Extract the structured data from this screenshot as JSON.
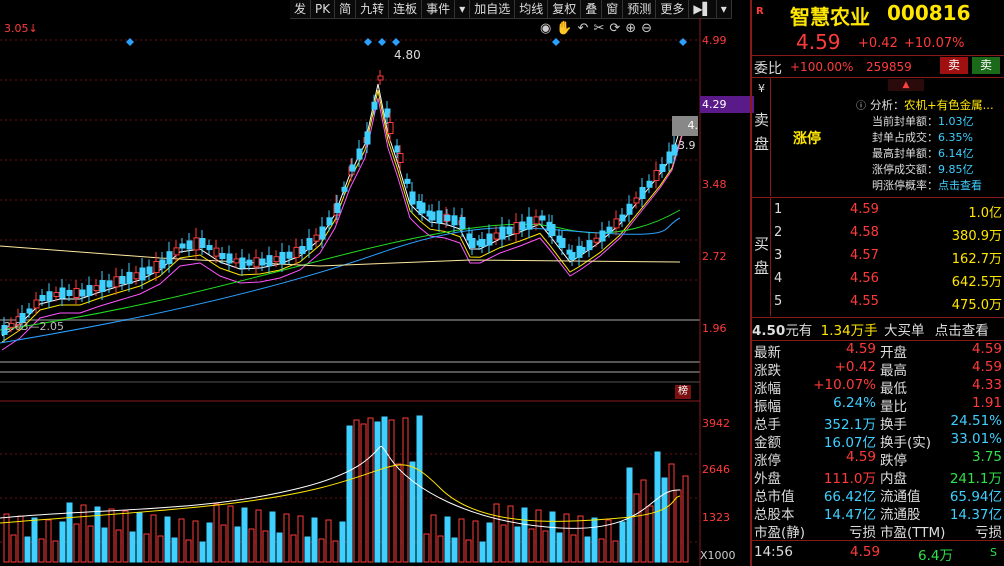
{
  "toolbar": [
    "发",
    "PK",
    "简",
    "九转",
    "连板",
    "事件",
    "▾",
    "加自选",
    "均线",
    "复权",
    "叠",
    "窗",
    "预测",
    "更多",
    "▶▌",
    "▾"
  ],
  "chart": {
    "top_left_label": "3.05↓",
    "peak_label": "4.80",
    "low_label": "2.03—2.05",
    "current_tag": "4.29",
    "mini_tag_a": "4.",
    "mini_tag_b": "3.9",
    "price_axis": [
      "4.99",
      "3.48",
      "2.72",
      "1.96"
    ],
    "volume_axis": [
      "3942",
      "2646",
      "1323"
    ],
    "volume_unit": "X1000",
    "bang_label": "榜"
  },
  "header": {
    "badge": "R",
    "name": "智慧农业",
    "code": "000816",
    "price": "4.59",
    "change": "+0.42",
    "change_pct": "+10.07%"
  },
  "weibi": {
    "label": "委比",
    "ratio": "+100.00%",
    "volume": "259859",
    "sell_btn": "卖",
    "buy_btn": "卖"
  },
  "sell_panel": {
    "currency": "¥",
    "side_label": "卖盘",
    "limit_up": "涨停",
    "analysis_title": "分析：",
    "analysis_topic": "农机+有色金属...",
    "info": [
      {
        "k": "当前封单额：",
        "v": "1.03亿"
      },
      {
        "k": "封单占成交：",
        "v": "6.35%"
      },
      {
        "k": "最高封单额：",
        "v": "6.14亿"
      },
      {
        "k": "涨停成交额：",
        "v": "9.85亿"
      },
      {
        "k": "明涨停概率：",
        "v": "点击查看"
      }
    ]
  },
  "buy_panel": {
    "side_label": "买盘",
    "rows": [
      {
        "lvl": "1",
        "price": "4.59",
        "vol": "1.0亿"
      },
      {
        "lvl": "2",
        "price": "4.58",
        "vol": "380.9万"
      },
      {
        "lvl": "3",
        "price": "4.57",
        "vol": "162.7万"
      },
      {
        "lvl": "4",
        "price": "4.56",
        "vol": "642.5万"
      },
      {
        "lvl": "5",
        "price": "4.55",
        "vol": "475.0万"
      }
    ]
  },
  "big_order": {
    "price": "4.50",
    "text1": "元有",
    "amount": "1.34万手",
    "text2": "大买单",
    "link": "点击查看"
  },
  "stats": [
    {
      "l": "最新",
      "lv": "4.59",
      "lc": "red",
      "r": "开盘",
      "rv": "4.59",
      "rc": "red"
    },
    {
      "l": "涨跌",
      "lv": "+0.42",
      "lc": "red",
      "r": "最高",
      "rv": "4.59",
      "rc": "red"
    },
    {
      "l": "涨幅",
      "lv": "+10.07%",
      "lc": "red",
      "r": "最低",
      "rv": "4.33",
      "rc": "red"
    },
    {
      "l": "振幅",
      "lv": "6.24%",
      "lc": "cyan",
      "r": "量比",
      "rv": "1.91",
      "rc": "red"
    },
    {
      "l": "总手",
      "lv": "352.1万",
      "lc": "cyan",
      "r": "换手",
      "rv": "24.51%",
      "rc": "cyan"
    },
    {
      "l": "金额",
      "lv": "16.07亿",
      "lc": "cyan",
      "r": "换手(实)",
      "rv": "33.01%",
      "rc": "cyan"
    },
    {
      "l": "涨停",
      "lv": "4.59",
      "lc": "red",
      "r": "跌停",
      "rv": "3.75",
      "rc": "green"
    },
    {
      "l": "外盘",
      "lv": "111.0万",
      "lc": "red",
      "r": "内盘",
      "rv": "241.1万",
      "rc": "green"
    },
    {
      "l": "总市值",
      "lv": "66.42亿",
      "lc": "cyan",
      "r": "流通值",
      "rv": "65.94亿",
      "rc": "cyan"
    },
    {
      "l": "总股本",
      "lv": "14.47亿",
      "lc": "cyan",
      "r": "流通股",
      "rv": "14.37亿",
      "rc": "cyan"
    },
    {
      "l": "市盈(静)",
      "lv": "亏损",
      "lc": "white",
      "r": "市盈(TTM)",
      "rv": "亏损",
      "rc": "white"
    }
  ],
  "tick": {
    "time": "14:56",
    "price": "4.59",
    "vol": "6.4万",
    "flag": "S"
  },
  "colors": {
    "up": "#ff3b3b",
    "down": "#3fd0ff",
    "ma5": "#ffffff",
    "ma10": "#ffe600",
    "ma20": "#ff55ff",
    "ma60": "#22dd22",
    "ma120": "#2aa0ff",
    "frame": "#8a1a1a"
  }
}
